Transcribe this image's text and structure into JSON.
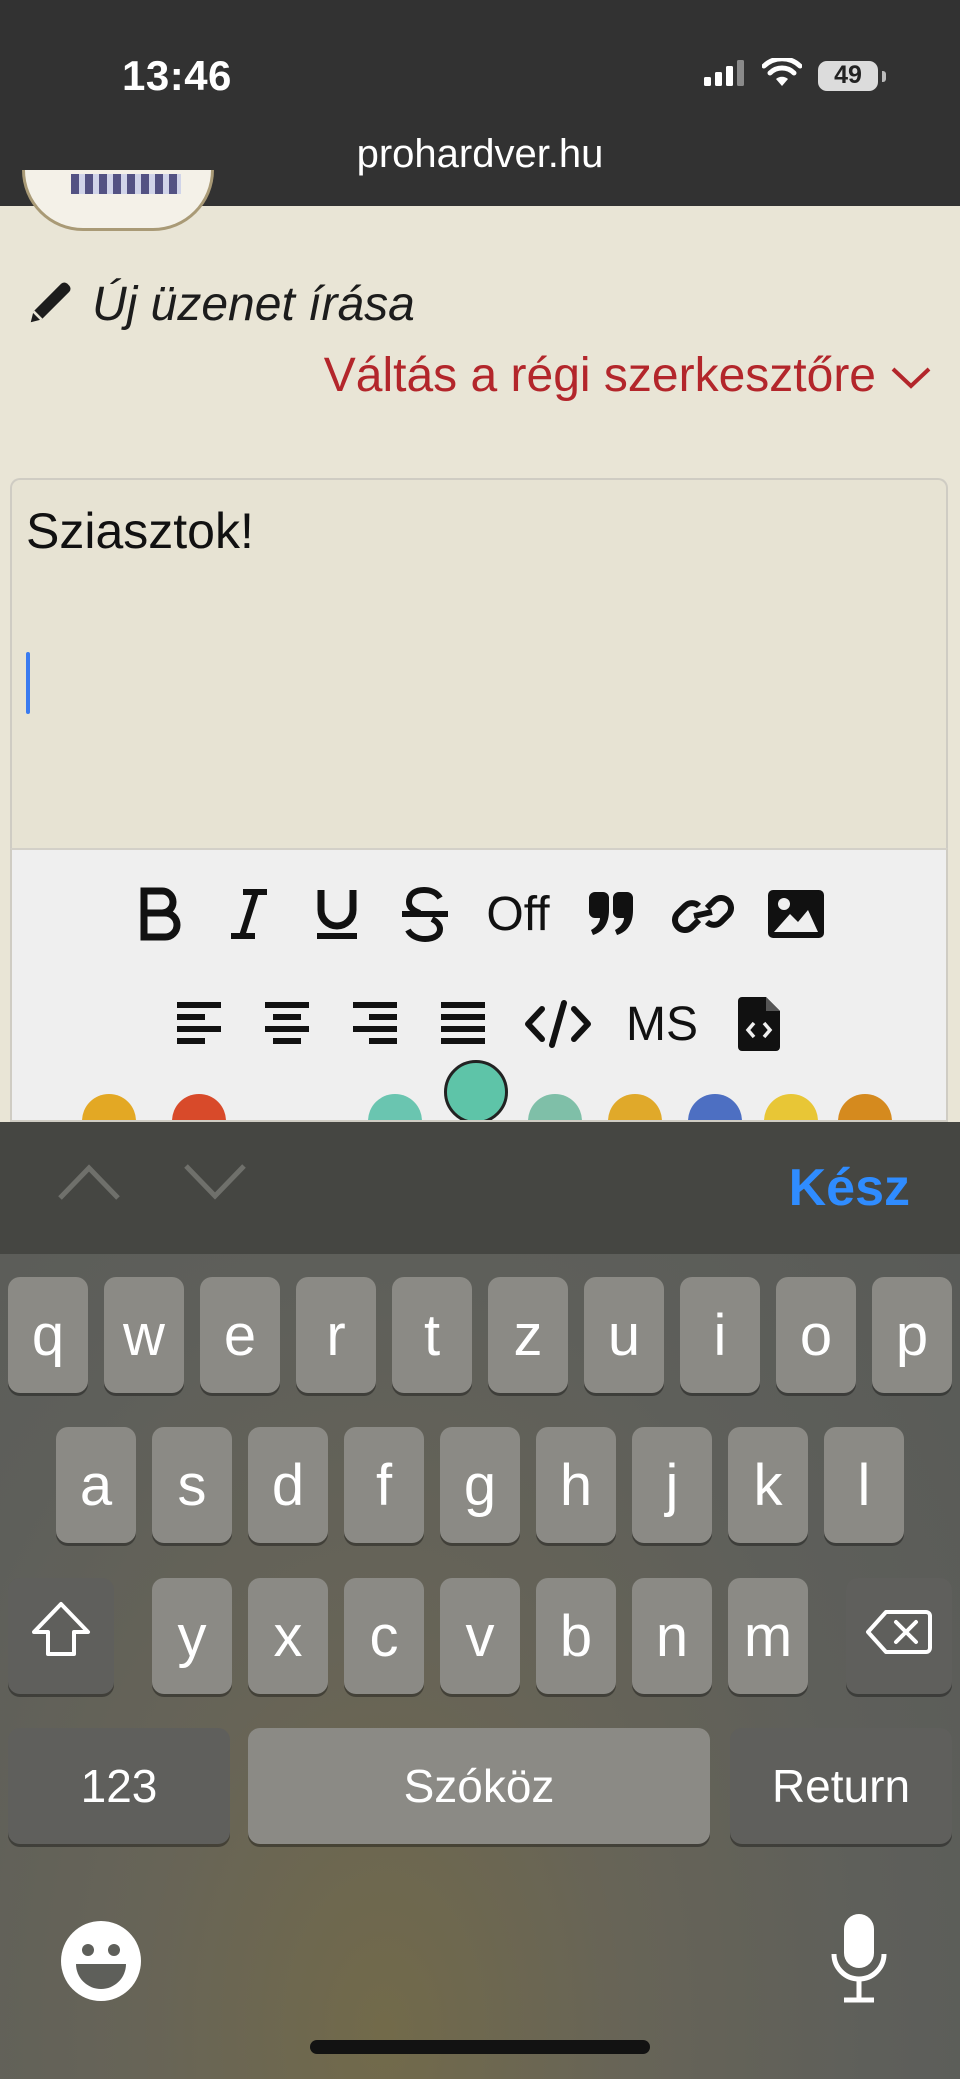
{
  "status_bar": {
    "time": "13:46",
    "battery": "49",
    "icons": [
      "cellular-signal-icon",
      "wifi-icon",
      "battery-icon"
    ]
  },
  "browser": {
    "url": "prohardver.hu"
  },
  "compose": {
    "title": "Új üzenet írása",
    "switch_editor": "Váltás a régi szerkesztőre",
    "editor_text": "Sziasztok!"
  },
  "toolbar": {
    "off_label": "Off",
    "ms_label": "MS",
    "row1_icons": [
      "bold-icon",
      "italic-icon",
      "underline-icon",
      "strikethrough-icon",
      "off-toggle",
      "quote-icon",
      "link-icon",
      "image-icon"
    ],
    "row2_icons": [
      "align-left-icon",
      "align-center-icon",
      "align-right-icon",
      "align-justify-icon",
      "code-icon",
      "ms-button",
      "code-file-icon"
    ]
  },
  "keyboard": {
    "done": "Kész",
    "row1": [
      "q",
      "w",
      "e",
      "r",
      "t",
      "z",
      "u",
      "i",
      "o",
      "p"
    ],
    "row2": [
      "a",
      "s",
      "d",
      "f",
      "g",
      "h",
      "j",
      "k",
      "l"
    ],
    "row3": [
      "y",
      "x",
      "c",
      "v",
      "b",
      "n",
      "m"
    ],
    "numbers_key": "123",
    "space_key": "Szóköz",
    "return_key": "Return"
  },
  "colors": {
    "link_red": "#b3262b",
    "accent_blue": "#2f8cff",
    "page_bg": "#e9e5d6"
  }
}
